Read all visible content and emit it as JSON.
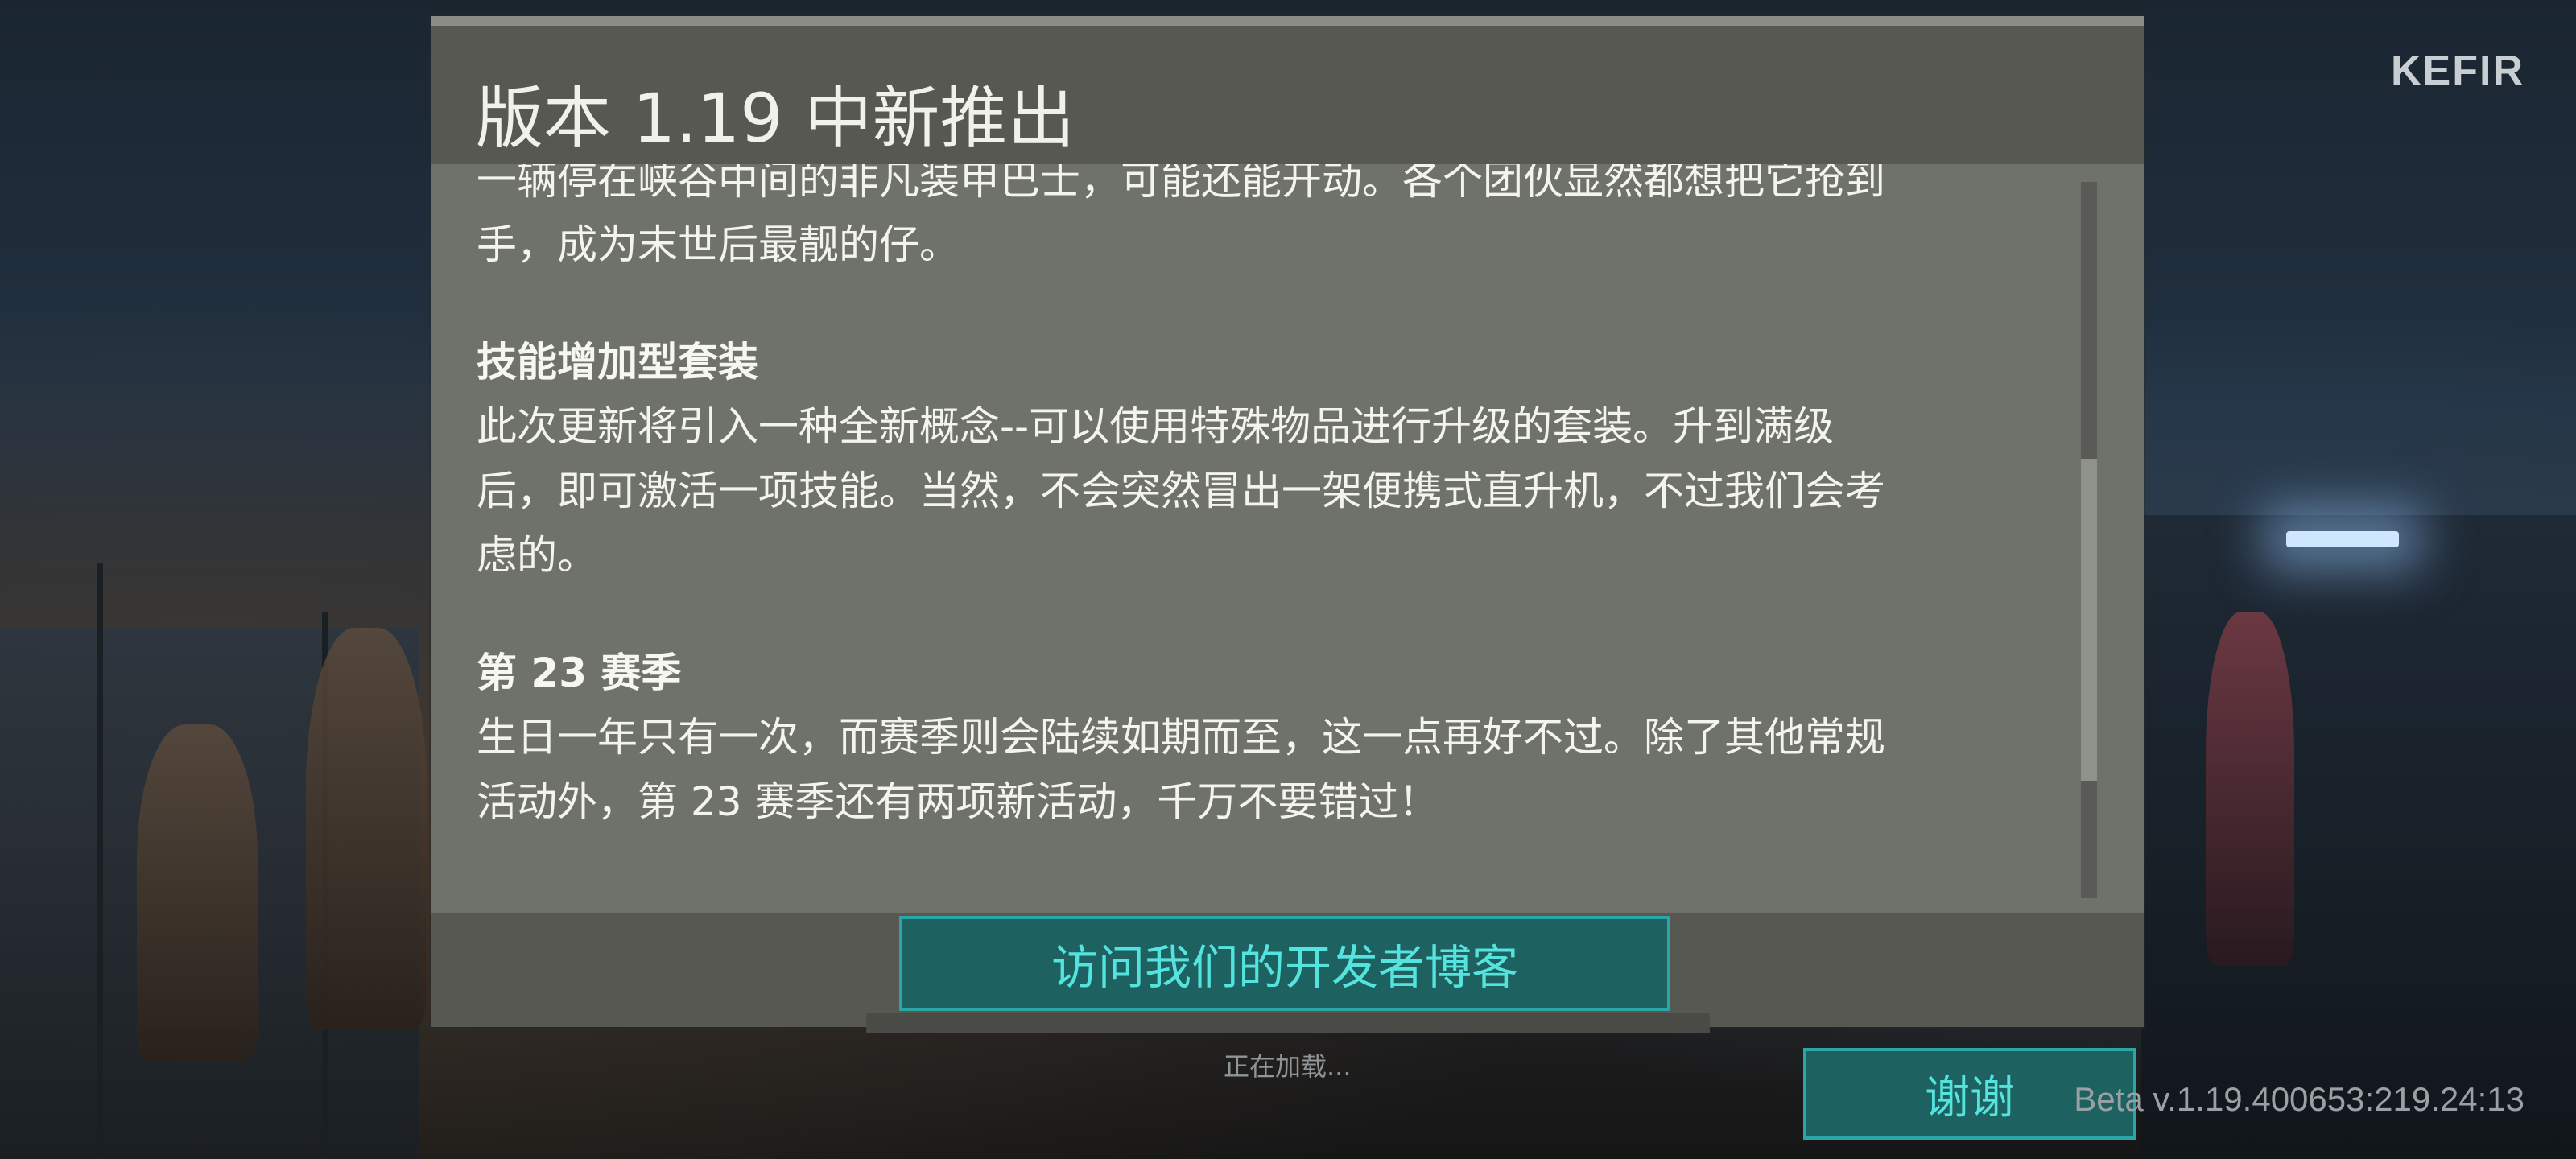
{
  "brand": {
    "logo_text": "KEFIR"
  },
  "dialog": {
    "title": "版本 1.19 中新推出",
    "cut_off_line": "一辆停在峡谷中间的非凡装甲巴士，可能还能开动。各个团伙显然都想把它抢到",
    "intro_tail": "手，成为末世后最靓的仔。",
    "sections": [
      {
        "heading": "技能增加型套装",
        "lines": [
          "此次更新将引入一种全新概念--可以使用特殊物品进行升级的套装。升到满级",
          "后，即可激活一项技能。当然，不会突然冒出一架便携式直升机，不过我们会考",
          "虑的。"
        ]
      },
      {
        "heading": "第 23 赛季",
        "lines": [
          "生日一年只有一次，而赛季则会陆续如期而至，这一点再好不过。除了其他常规",
          "活动外，第 23 赛季还有两项新活动，千万不要错过！"
        ]
      }
    ],
    "blog_button_label": "访问我们的开发者博客"
  },
  "loading_text": "正在加载...",
  "thanks_button_label": "谢谢",
  "version": "Beta v.1.19.400653:219.24:13",
  "colors": {
    "accent": "#54e3dd",
    "button_bg": "#1d6161",
    "dialog_bg": "#6f716b",
    "header_bg": "#575852"
  }
}
